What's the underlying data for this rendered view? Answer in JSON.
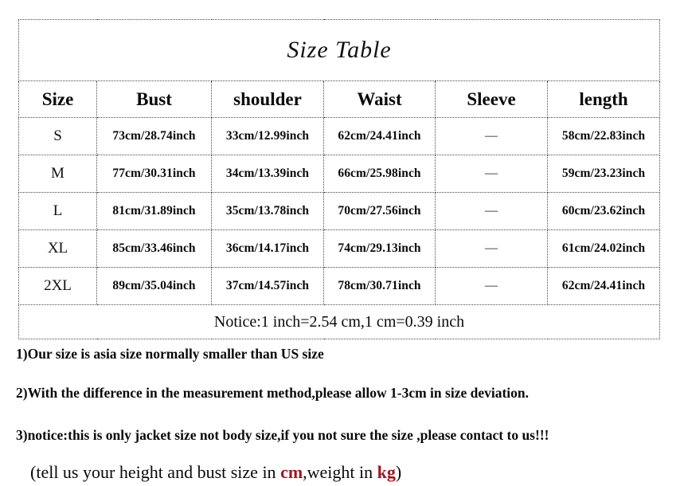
{
  "table": {
    "title": "Size  Table",
    "headers": [
      "Size",
      "Bust",
      "shoulder",
      "Waist",
      "Sleeve",
      "length"
    ],
    "rows": [
      {
        "size": "S",
        "bust": "73cm/28.74inch",
        "shoulder": "33cm/12.99inch",
        "waist": "62cm/24.41inch",
        "sleeve": "—",
        "length": "58cm/22.83inch"
      },
      {
        "size": "M",
        "bust": "77cm/30.31inch",
        "shoulder": "34cm/13.39inch",
        "waist": "66cm/25.98inch",
        "sleeve": "—",
        "length": "59cm/23.23inch"
      },
      {
        "size": "L",
        "bust": "81cm/31.89inch",
        "shoulder": "35cm/13.78inch",
        "waist": "70cm/27.56inch",
        "sleeve": "—",
        "length": "60cm/23.62inch"
      },
      {
        "size": "XL",
        "bust": "85cm/33.46inch",
        "shoulder": "36cm/14.17inch",
        "waist": "74cm/29.13inch",
        "sleeve": "—",
        "length": "61cm/24.02inch"
      },
      {
        "size": "2XL",
        "bust": "89cm/35.04inch",
        "shoulder": "37cm/14.57inch",
        "waist": "78cm/30.71inch",
        "sleeve": "—",
        "length": "62cm/24.41inch"
      }
    ],
    "notice": "Notice:1 inch=2.54 cm,1 cm=0.39 inch"
  },
  "notes": {
    "note_1": "1)Our size is asia size normally smaller than US size",
    "note_2": "2)With the difference in the measurement method,please allow 1-3cm in size deviation.",
    "note_3": "3)notice:this is only jacket size not body size,if you not sure the size ,please contact to us!!!",
    "final_prefix": "(tell us your height and bust size in ",
    "final_unit_1": "cm",
    "final_middle": ",weight in ",
    "final_unit_2": "kg",
    "final_suffix": ")"
  },
  "colors": {
    "highlight_red": "#9e1420",
    "border": "#4a4a4a",
    "text": "#0a0a0a",
    "background": "#ffffff"
  }
}
